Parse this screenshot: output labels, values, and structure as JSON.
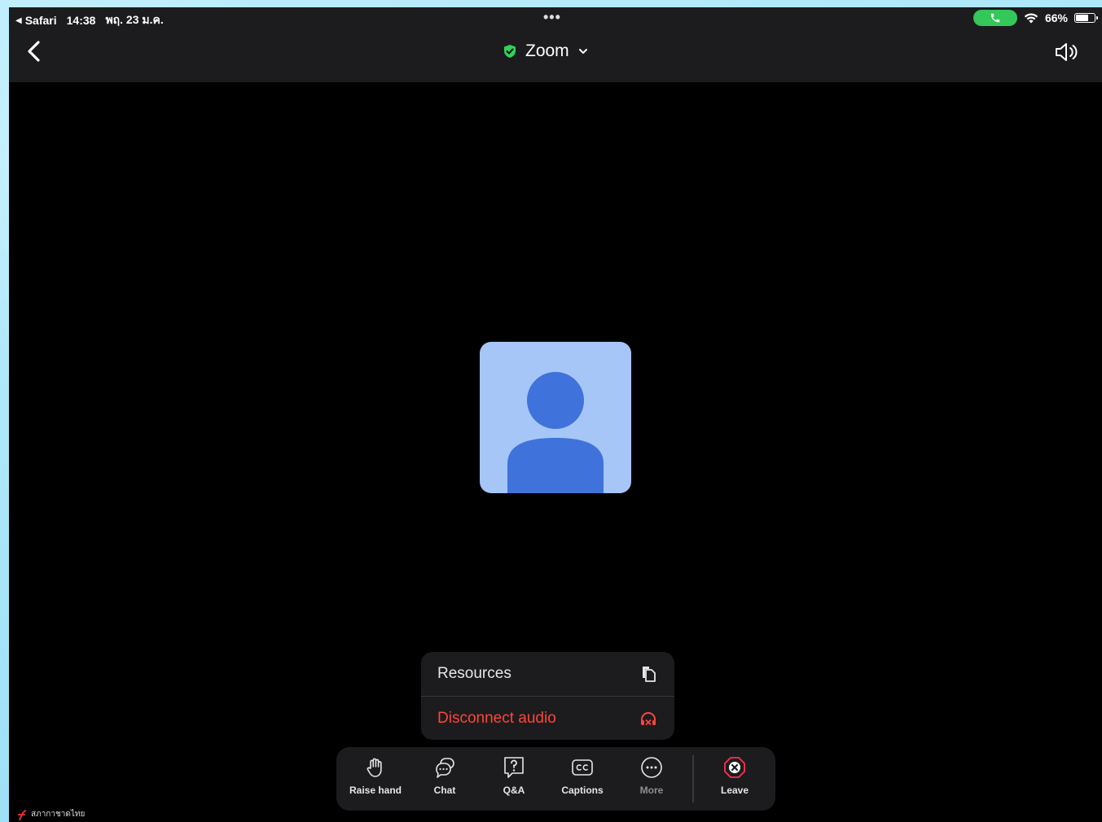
{
  "status_bar": {
    "back_app": "Safari",
    "time": "14:38",
    "date": "พฤ. 23 ม.ค.",
    "dots": "•••",
    "battery_percent": "66%",
    "battery_level": 0.66,
    "call_active_color": "#34c759"
  },
  "header": {
    "title": "Zoom",
    "secure_color": "#30d158",
    "back_icon": "chevron-left-icon",
    "speaker_icon": "speaker-icon"
  },
  "participant": {
    "avatar_color": "#a6c6f7",
    "avatar_figure_color": "#3f73db"
  },
  "menu": {
    "items": [
      {
        "label": "Resources",
        "icon": "document-copy-icon"
      },
      {
        "label": "Disconnect audio",
        "icon": "headphones-disconnect-icon",
        "color": "#ff453a"
      }
    ]
  },
  "toolbar": {
    "buttons": [
      {
        "label": "Raise hand",
        "icon": "hand-icon"
      },
      {
        "label": "Chat",
        "icon": "chat-icon"
      },
      {
        "label": "Q&A",
        "icon": "question-icon"
      },
      {
        "label": "Captions",
        "icon": "captions-icon"
      },
      {
        "label": "More",
        "icon": "more-icon"
      },
      {
        "label": "Leave",
        "icon": "leave-icon",
        "color": "#ff2d55"
      }
    ]
  },
  "watermark": {
    "text": "สภากาชาดไทย"
  }
}
